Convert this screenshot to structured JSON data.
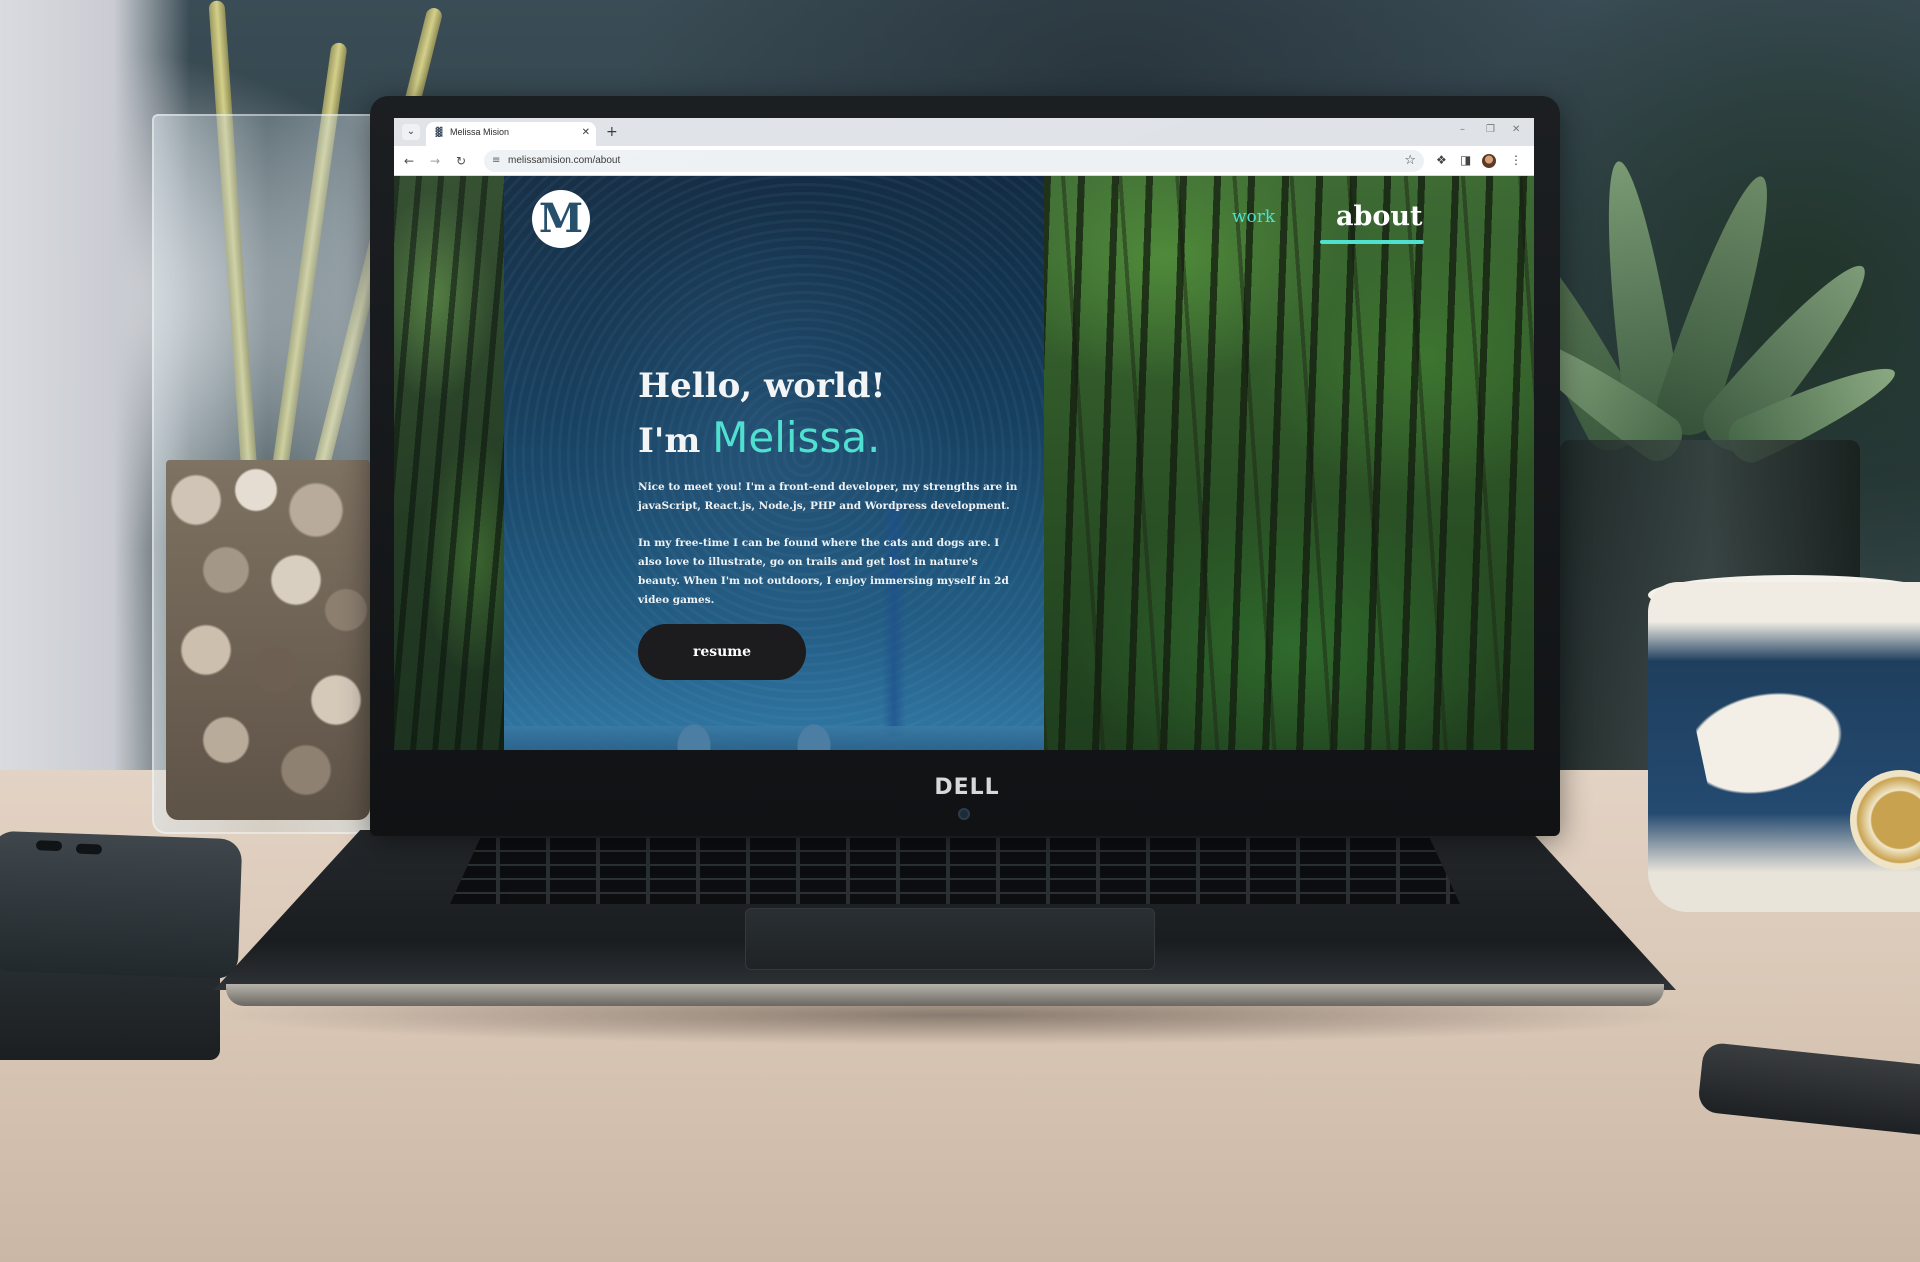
{
  "scene": {
    "laptop_brand": "DELL"
  },
  "browser": {
    "tab_title": "Melissa Mision",
    "url": "melissamision.com/about",
    "icons": {
      "tab_menu": "chevron-down-icon",
      "new_tab": "plus-icon",
      "back": "arrow-left-icon",
      "forward": "arrow-right-icon",
      "reload": "reload-icon",
      "site_info": "tune-icon",
      "bookmark": "star-icon",
      "extensions": "puzzle-icon",
      "side_panel": "side-panel-icon",
      "menu": "kebab-menu-icon"
    }
  },
  "site": {
    "logo_letter": "M",
    "nav": {
      "work": "work",
      "about": "about",
      "active": "about"
    },
    "hero": {
      "greeting": "Hello, world!",
      "intro_prefix": "I'm",
      "name": "Melissa."
    },
    "paragraphs": [
      "Nice to meet you! I'm a front-end developer, my strengths are in javaScript, React.js, Node.js, PHP and Wordpress development.",
      "In my free-time I can be found where the cats and dogs are. I also love to illustrate, go on trails and get lost in nature's beauty. When I'm not outdoors, I enjoy immersing myself in 2d video games."
    ],
    "resume_label": "resume",
    "colors": {
      "accent": "#4fe0cf",
      "hero_top": "#0f2840",
      "hero_bottom": "#3179a6",
      "button": "#1c1c1e"
    }
  }
}
